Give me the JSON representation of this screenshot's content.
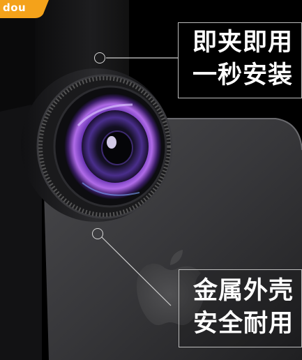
{
  "brand": {
    "text": "dou",
    "color": "#f4a21a"
  },
  "callouts": [
    {
      "line1": "即夹即用",
      "line2": "一秒安装"
    },
    {
      "line1": "金属外壳",
      "line2": "安全耐用"
    }
  ],
  "colors": {
    "background": "#000000",
    "phone": "#3a3a3c",
    "lens_glow": "#8a3ad8",
    "callout_border": "#bdbdbd"
  }
}
